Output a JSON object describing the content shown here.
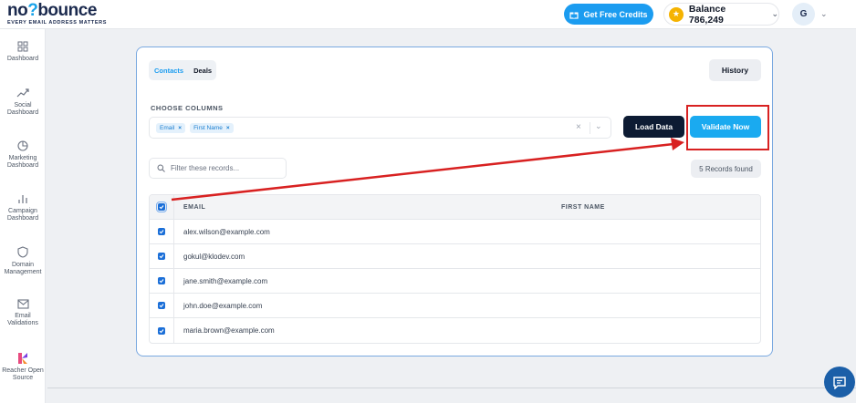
{
  "brand": {
    "logo_part1": "no",
    "logo_part2": "bounce",
    "tagline": "EVERY EMAIL ADDRESS MATTERS"
  },
  "header": {
    "free_credits_label": "Get Free Credits",
    "balance_label": "Balance 786,249",
    "avatar_initial": "G"
  },
  "sidebar": {
    "items": [
      {
        "label": "Dashboard",
        "icon": "grid-icon"
      },
      {
        "label": "Social Dashboard",
        "icon": "trend-icon"
      },
      {
        "label": "Marketing Dashboard",
        "icon": "pie-icon"
      },
      {
        "label": "Campaign Dashboard",
        "icon": "bar-icon"
      },
      {
        "label": "Domain Management",
        "icon": "shield-icon"
      },
      {
        "label": "Email Validations",
        "icon": "mail-icon"
      },
      {
        "label": "Reacher Open Source",
        "icon": "reacher-logo"
      }
    ]
  },
  "main": {
    "tabs": [
      {
        "label": "Contacts",
        "active": true
      },
      {
        "label": "Deals",
        "active": false
      }
    ],
    "history_label": "History",
    "choose_columns_label": "CHOOSE COLUMNS",
    "selected_columns": [
      "Email",
      "First Name"
    ],
    "load_data_label": "Load Data",
    "validate_label": "Validate Now",
    "filter_placeholder": "Filter these records...",
    "records_found": "5 Records found",
    "table": {
      "headers": [
        "EMAIL",
        "FIRST NAME"
      ],
      "rows": [
        {
          "email": "alex.wilson@example.com",
          "first_name": "",
          "checked": true
        },
        {
          "email": "gokul@klodev.com",
          "first_name": "",
          "checked": true
        },
        {
          "email": "jane.smith@example.com",
          "first_name": "",
          "checked": true
        },
        {
          "email": "john.doe@example.com",
          "first_name": "",
          "checked": true
        },
        {
          "email": "maria.brown@example.com",
          "first_name": "",
          "checked": true
        }
      ]
    }
  },
  "colors": {
    "accent": "#1aaaf0",
    "brand_dark": "#1b2a4e",
    "annotation": "#d82121"
  }
}
